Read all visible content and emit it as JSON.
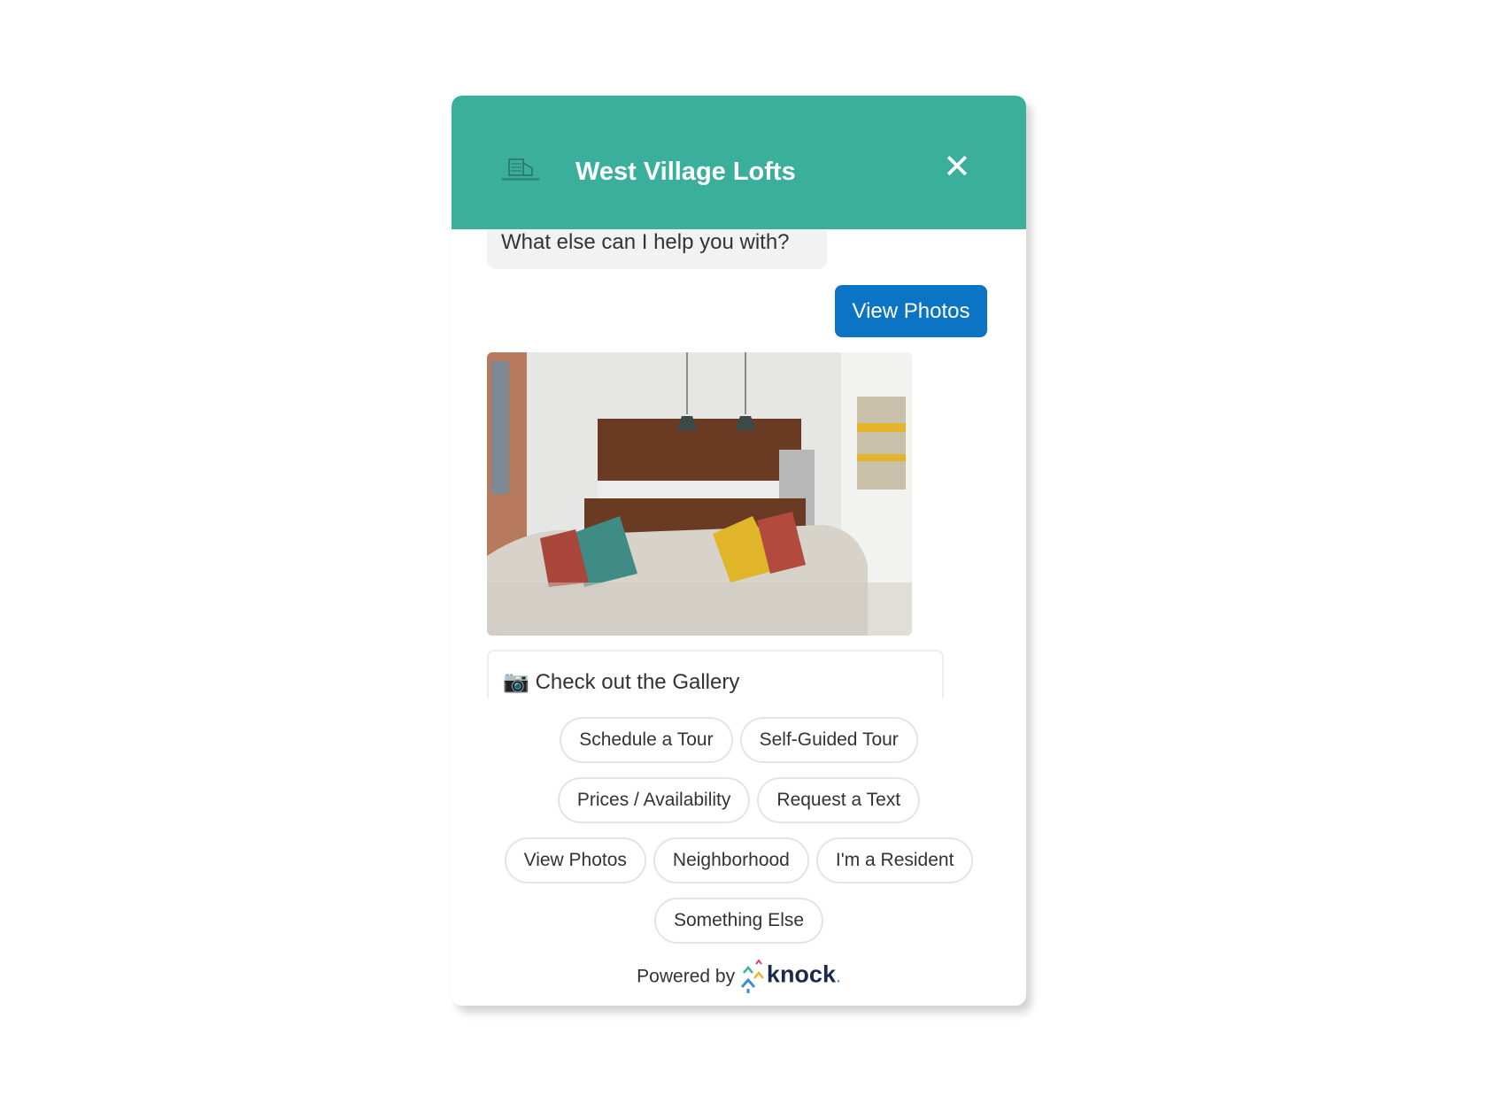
{
  "header": {
    "title": "West Village Lofts",
    "logo_text": "WEST VILLAGE LOFTS",
    "close_icon": "close-icon",
    "background": "#3ab09c"
  },
  "messages": {
    "bot_text": "What else can I help you with?",
    "user_choice": "View Photos",
    "gallery_link": "Check out the Gallery",
    "gallery_icon": "camera-icon"
  },
  "quick_replies": [
    "Schedule a Tour",
    "Self-Guided Tour",
    "Prices / Availability",
    "Request a Text",
    "View Photos",
    "Neighborhood",
    "I'm a Resident",
    "Something Else"
  ],
  "footer": {
    "powered_by": "Powered by",
    "brand": "knock",
    "brand_dot": "."
  },
  "colors": {
    "accent": "#3ab09c",
    "user_button": "#0b74c5"
  }
}
